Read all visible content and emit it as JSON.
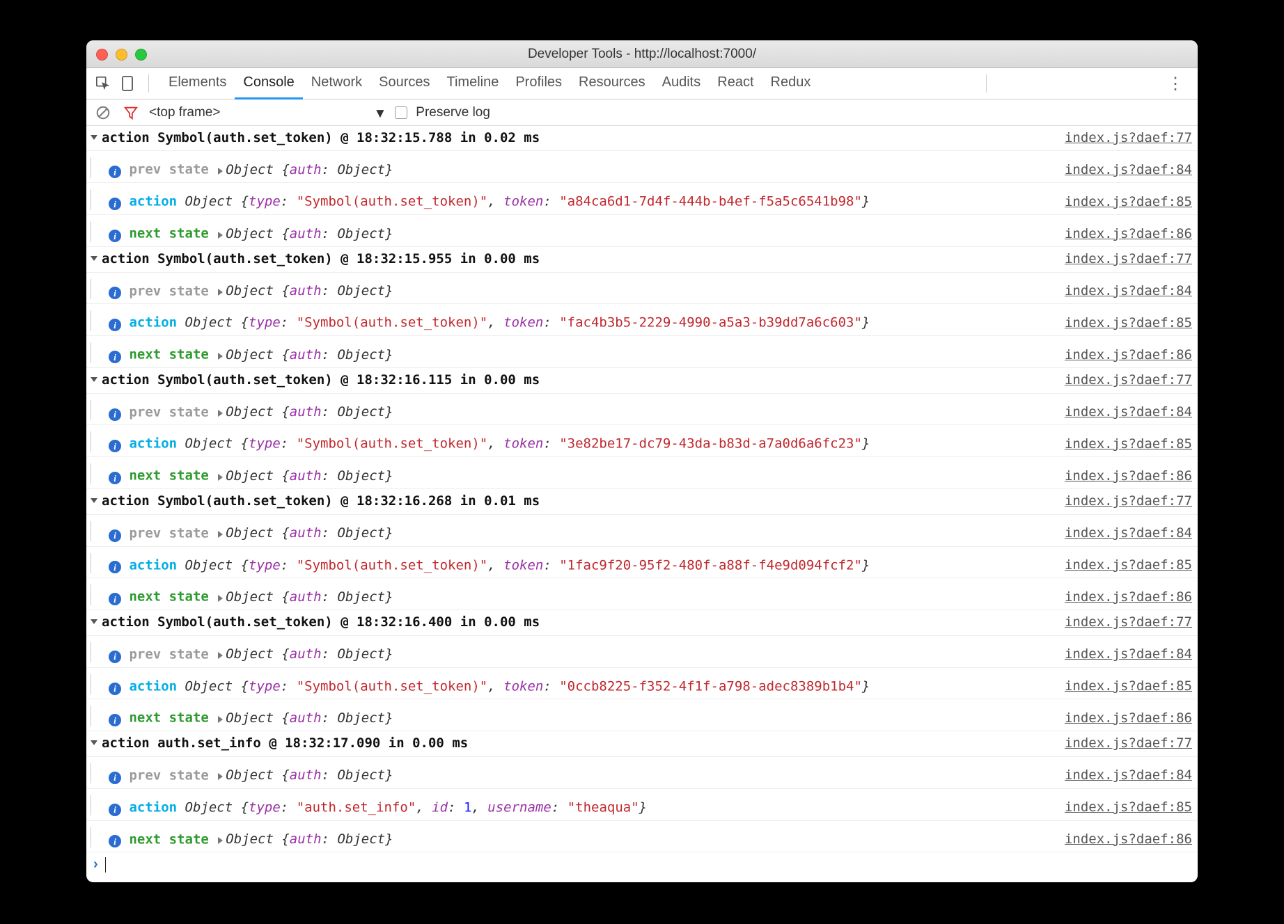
{
  "window": {
    "title": "Developer Tools - http://localhost:7000/"
  },
  "tabs": {
    "items": [
      "Elements",
      "Console",
      "Network",
      "Sources",
      "Timeline",
      "Profiles",
      "Resources",
      "Audits",
      "React",
      "Redux"
    ],
    "active": "Console"
  },
  "filter": {
    "context": "<top frame>",
    "preserve_label": "Preserve log",
    "preserve_checked": false
  },
  "src_base": "index.js?daef",
  "groups": [
    {
      "header": {
        "name": "Symbol(auth.set_token)",
        "time": "18:32:15.788",
        "ms": "0.02",
        "line": 77
      },
      "prev_line": 84,
      "action_line": 85,
      "next_line": 86,
      "action_obj": {
        "type_val": "\"Symbol(auth.set_token)\"",
        "extra_key": "token",
        "extra_val": "\"a84ca6d1-7d4f-444b-b4ef-f5a5c6541b98\"",
        "extra_is_str": true
      }
    },
    {
      "header": {
        "name": "Symbol(auth.set_token)",
        "time": "18:32:15.955",
        "ms": "0.00",
        "line": 77
      },
      "prev_line": 84,
      "action_line": 85,
      "next_line": 86,
      "action_obj": {
        "type_val": "\"Symbol(auth.set_token)\"",
        "extra_key": "token",
        "extra_val": "\"fac4b3b5-2229-4990-a5a3-b39dd7a6c603\"",
        "extra_is_str": true
      }
    },
    {
      "header": {
        "name": "Symbol(auth.set_token)",
        "time": "18:32:16.115",
        "ms": "0.00",
        "line": 77
      },
      "prev_line": 84,
      "action_line": 85,
      "next_line": 86,
      "action_obj": {
        "type_val": "\"Symbol(auth.set_token)\"",
        "extra_key": "token",
        "extra_val": "\"3e82be17-dc79-43da-b83d-a7a0d6a6fc23\"",
        "extra_is_str": true
      }
    },
    {
      "header": {
        "name": "Symbol(auth.set_token)",
        "time": "18:32:16.268",
        "ms": "0.01",
        "line": 77
      },
      "prev_line": 84,
      "action_line": 85,
      "next_line": 86,
      "action_obj": {
        "type_val": "\"Symbol(auth.set_token)\"",
        "extra_key": "token",
        "extra_val": "\"1fac9f20-95f2-480f-a88f-f4e9d094fcf2\"",
        "extra_is_str": true
      }
    },
    {
      "header": {
        "name": "Symbol(auth.set_token)",
        "time": "18:32:16.400",
        "ms": "0.00",
        "line": 77
      },
      "prev_line": 84,
      "action_line": 85,
      "next_line": 86,
      "action_obj": {
        "type_val": "\"Symbol(auth.set_token)\"",
        "extra_key": "token",
        "extra_val": "\"0ccb8225-f352-4f1f-a798-adec8389b1b4\"",
        "extra_is_str": true
      }
    },
    {
      "header": {
        "name": "auth.set_info",
        "time": "18:32:17.090",
        "ms": "0.00",
        "line": 77
      },
      "prev_line": 84,
      "action_line": 85,
      "next_line": 86,
      "action_obj": {
        "type_val": "\"auth.set_info\"",
        "extra_key": "id",
        "extra_val": "1",
        "extra_is_str": false,
        "extra2_key": "username",
        "extra2_val": "\"theaqua\""
      }
    }
  ],
  "labels": {
    "prev": "prev state",
    "action": "action",
    "next": "next state",
    "object": "Object",
    "auth_key": "auth",
    "type_key": "type"
  }
}
